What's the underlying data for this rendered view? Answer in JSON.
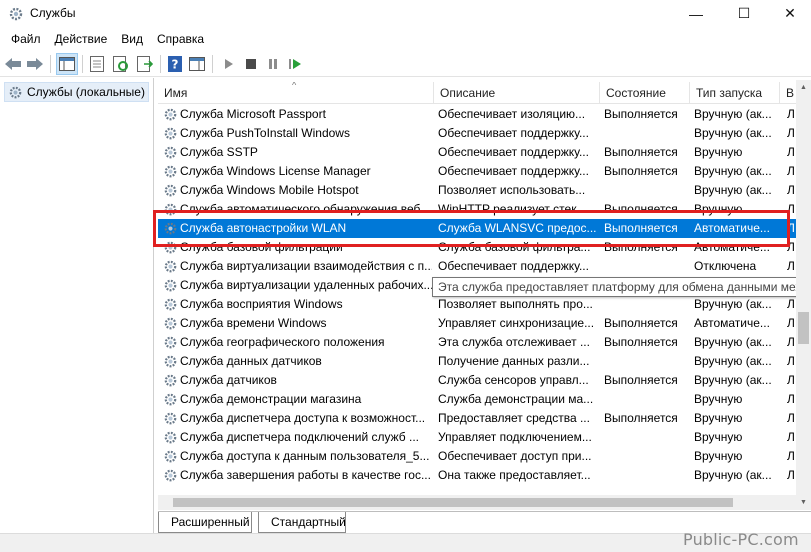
{
  "window": {
    "title": "Службы",
    "minimize": "—",
    "maximize": "☐",
    "close": "✕"
  },
  "menu": [
    "Файл",
    "Действие",
    "Вид",
    "Справка"
  ],
  "tree": {
    "label": "Службы (локальные)"
  },
  "columns": {
    "name": "Имя",
    "description": "Описание",
    "state": "Состояние",
    "startup": "Тип запуска",
    "more": "В"
  },
  "rows": [
    {
      "name": "Служба Microsoft Passport",
      "description": "Обеспечивает изоляцию...",
      "state": "Выполняется",
      "startup": "Вручную (ак...",
      "more": "Л"
    },
    {
      "name": "Служба PushToInstall Windows",
      "description": "Обеспечивает поддержку...",
      "state": "",
      "startup": "Вручную (ак...",
      "more": "Л"
    },
    {
      "name": "Служба SSTP",
      "description": "Обеспечивает поддержку...",
      "state": "Выполняется",
      "startup": "Вручную",
      "more": "Л"
    },
    {
      "name": "Служба Windows License Manager",
      "description": "Обеспечивает поддержку...",
      "state": "Выполняется",
      "startup": "Вручную (ак...",
      "more": "Л"
    },
    {
      "name": "Служба Windows Mobile Hotspot",
      "description": "Позволяет использовать...",
      "state": "",
      "startup": "Вручную (ак...",
      "more": "Л"
    },
    {
      "name": "Служба автоматического обнаружения веб...",
      "description": "WinHTTP реализует стек...",
      "state": "Выполняется",
      "startup": "Вручную",
      "more": "Л"
    },
    {
      "name": "Служба автонастройки WLAN",
      "description": "Служба WLANSVC предос...",
      "state": "Выполняется",
      "startup": "Автоматиче...",
      "more": "Л",
      "selected": true
    },
    {
      "name": "Служба базовой фильтрации",
      "description": "Служба базовой фильтра...",
      "state": "Выполняется",
      "startup": "Автоматиче...",
      "more": "Л"
    },
    {
      "name": "Служба виртуализации взаимодействия с п...",
      "description": "Обеспечивает поддержку...",
      "state": "",
      "startup": "Отключена",
      "more": "Л"
    },
    {
      "name": "Служба виртуализации удаленных рабочих...",
      "description": "",
      "state": "",
      "startup": "",
      "more": ""
    },
    {
      "name": "Служба восприятия Windows",
      "description": "Позволяет выполнять про...",
      "state": "",
      "startup": "Вручную (ак...",
      "more": "Л"
    },
    {
      "name": "Служба времени Windows",
      "description": "Управляет синхронизацие...",
      "state": "Выполняется",
      "startup": "Автоматиче...",
      "more": "Л"
    },
    {
      "name": "Служба географического положения",
      "description": "Эта служба отслеживает ...",
      "state": "Выполняется",
      "startup": "Вручную (ак...",
      "more": "Л"
    },
    {
      "name": "Служба данных датчиков",
      "description": "Получение данных разли...",
      "state": "",
      "startup": "Вручную (ак...",
      "more": "Л"
    },
    {
      "name": "Служба датчиков",
      "description": "Служба сенсоров управл...",
      "state": "Выполняется",
      "startup": "Вручную (ак...",
      "more": "Л"
    },
    {
      "name": "Служба демонстрации магазина",
      "description": "Служба демонстрации ма...",
      "state": "",
      "startup": "Вручную",
      "more": "Л"
    },
    {
      "name": "Служба диспетчера доступа к возможност...",
      "description": "Предоставляет средства ...",
      "state": "Выполняется",
      "startup": "Вручную",
      "more": "Л"
    },
    {
      "name": "Служба диспетчера подключений служб ...",
      "description": "Управляет подключением...",
      "state": "",
      "startup": "Вручную",
      "more": "Л"
    },
    {
      "name": "Служба доступа к данным пользователя_5...",
      "description": "Обеспечивает доступ при...",
      "state": "",
      "startup": "Вручную",
      "more": "Л"
    },
    {
      "name": "Служба завершения работы в качестве гос...",
      "description": "Она также предоставляет...",
      "state": "",
      "startup": "Вручную (ак...",
      "more": "Л"
    }
  ],
  "tooltip": "Эта служба предоставляет платформу для обмена данными между",
  "tabs": [
    "Расширенный",
    "Стандартный"
  ],
  "watermark": "Public-PC.com",
  "colors": {
    "selection": "#0078d7",
    "highlight_box": "#e02020",
    "toolbar_accent": "#1e6fd0"
  }
}
